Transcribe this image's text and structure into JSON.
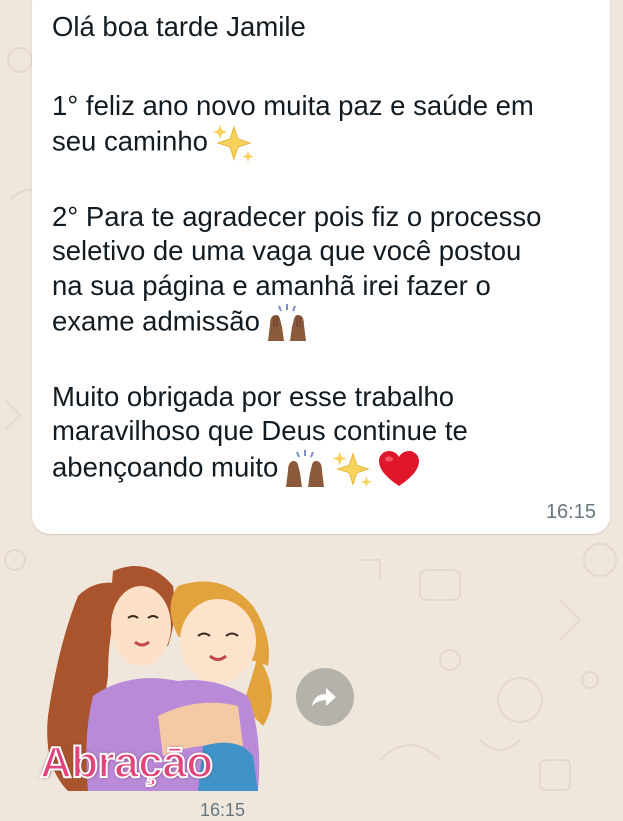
{
  "message": {
    "greeting": "Olá boa tarde Jamile",
    "p1_line1": "1° feliz ano novo muita paz e saúde em",
    "p1_line2": "seu caminho",
    "p2_line1": "2° Para te agradecer pois fiz o processo",
    "p2_line2": "seletivo de uma vaga que você postou",
    "p2_line3": "na sua página e amanhã irei fazer o",
    "p2_line4": "exame admissão",
    "p3_line1": "Muito obrigada por esse trabalho",
    "p3_line2": "maravilhoso que Deus continue te",
    "p3_line3": "abençoando muito",
    "time": "16:15"
  },
  "sticker": {
    "label": "Abraçāo",
    "time": "16:15"
  },
  "icons": {
    "sparkles": "sparkles-icon",
    "raised_hands": "raised-hands-icon",
    "heart": "red-heart-icon",
    "forward": "forward-icon"
  },
  "colors": {
    "wallpaper": "#efe7dc",
    "bubble": "#ffffff",
    "text": "#111b21",
    "timestamp": "#667781",
    "sticker_text": "#e0447a",
    "heart": "#e0162b"
  }
}
